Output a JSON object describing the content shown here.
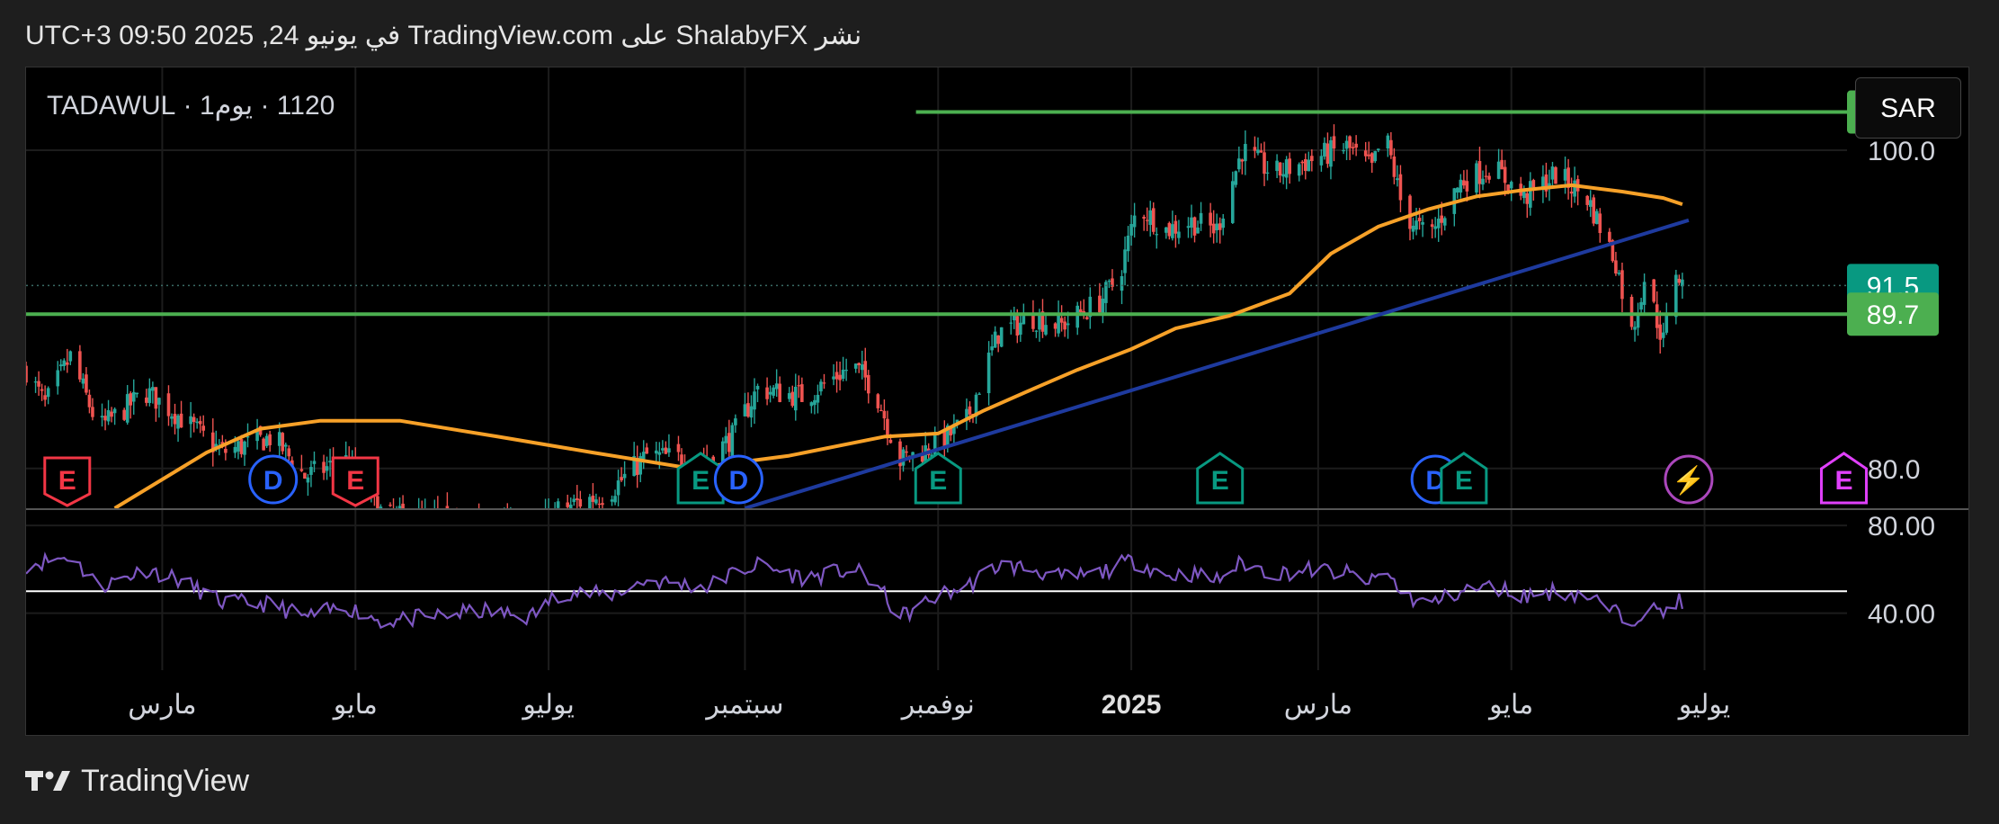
{
  "header": {
    "published": "نشر ShalabyFX على TradingView.com في يونيو 24, 2025 09:50 UTC+3"
  },
  "symbol_line": "1120 · يوم1 · TADAWUL",
  "currency_button": "SAR",
  "footer": {
    "brand": "TradingView",
    "logo_icon": "tradingview-logo-icon"
  },
  "colors": {
    "up": "#26a69a",
    "down": "#ef5350",
    "ema": "#f7a128",
    "trend": "#1e3a9e",
    "hline": "#4caf50",
    "rsi": "#7e57c2",
    "last_price_tag": "#089981",
    "level_tag": "#4caf50"
  },
  "chart_data": [
    {
      "type": "candlestick",
      "x_axis_labels": [
        "مارس",
        "مايو",
        "يوليو",
        "سبتمبر",
        "نوفمبر",
        "2025",
        "مارس",
        "مايو",
        "يوليو"
      ],
      "x_axis_dates": [
        "2024-03-01",
        "2024-05-01",
        "2024-07-01",
        "2024-09-01",
        "2024-11-01",
        "2025-01-01",
        "2025-03-01",
        "2025-05-01",
        "2025-07-01"
      ],
      "x_range": [
        "2024-01-18",
        "2025-08-15"
      ],
      "y_tick_labels": [
        "100.0",
        "80.0"
      ],
      "y_range": [
        77.5,
        105.2
      ],
      "price_keypoints": [
        [
          "2024-01-18",
          86.2
        ],
        [
          "2024-01-24",
          84.0
        ],
        [
          "2024-02-01",
          87.0
        ],
        [
          "2024-02-10",
          82.5
        ],
        [
          "2024-02-25",
          84.8
        ],
        [
          "2024-03-05",
          83.5
        ],
        [
          "2024-03-20",
          81.0
        ],
        [
          "2024-04-05",
          82.0
        ],
        [
          "2024-04-15",
          79.5
        ],
        [
          "2024-04-28",
          80.5
        ],
        [
          "2024-05-10",
          77.0
        ],
        [
          "2024-06-10",
          76.5
        ],
        [
          "2024-06-25",
          76.0
        ],
        [
          "2024-07-05",
          77.5
        ],
        [
          "2024-07-20",
          78.5
        ],
        [
          "2024-08-01",
          80.8
        ],
        [
          "2024-08-20",
          80.5
        ],
        [
          "2024-08-28",
          82.0
        ],
        [
          "2024-09-05",
          85.0
        ],
        [
          "2024-09-20",
          84.5
        ],
        [
          "2024-10-05",
          86.5
        ],
        [
          "2024-10-12",
          85.0
        ],
        [
          "2024-10-20",
          80.5
        ],
        [
          "2024-11-01",
          81.5
        ],
        [
          "2024-11-10",
          83.0
        ],
        [
          "2024-11-20",
          88.5
        ],
        [
          "2024-12-01",
          89.5
        ],
        [
          "2024-12-10",
          89.0
        ],
        [
          "2024-12-22",
          90.5
        ],
        [
          "2024-12-28",
          92.0
        ],
        [
          "2025-01-03",
          96.5
        ],
        [
          "2025-01-12",
          95.0
        ],
        [
          "2025-01-20",
          95.5
        ],
        [
          "2025-01-28",
          95.0
        ],
        [
          "2025-02-05",
          100.0
        ],
        [
          "2025-02-15",
          98.5
        ],
        [
          "2025-02-28",
          99.5
        ],
        [
          "2025-03-10",
          100.2
        ],
        [
          "2025-03-18",
          98.8
        ],
        [
          "2025-03-22",
          101.2
        ],
        [
          "2025-03-28",
          96.0
        ],
        [
          "2025-04-05",
          94.5
        ],
        [
          "2025-04-15",
          98.0
        ],
        [
          "2025-04-25",
          99.0
        ],
        [
          "2025-05-05",
          97.0
        ],
        [
          "2025-05-15",
          98.5
        ],
        [
          "2025-05-25",
          97.0
        ],
        [
          "2025-06-03",
          93.0
        ],
        [
          "2025-06-08",
          88.5
        ],
        [
          "2025-06-12",
          92.0
        ],
        [
          "2025-06-18",
          88.0
        ],
        [
          "2025-06-22",
          92.5
        ],
        [
          "2025-06-24",
          91.5
        ]
      ],
      "ema_keypoints": [
        [
          "2024-02-15",
          77.5
        ],
        [
          "2024-03-15",
          81.0
        ],
        [
          "2024-04-01",
          82.5
        ],
        [
          "2024-04-20",
          83.0
        ],
        [
          "2024-05-15",
          83.0
        ],
        [
          "2024-06-15",
          82.0
        ],
        [
          "2024-07-15",
          81.0
        ],
        [
          "2024-08-15",
          80.0
        ],
        [
          "2024-09-15",
          80.8
        ],
        [
          "2024-10-15",
          82.0
        ],
        [
          "2024-11-01",
          82.2
        ],
        [
          "2024-11-15",
          83.6
        ],
        [
          "2024-12-01",
          85.0
        ],
        [
          "2024-12-15",
          86.2
        ],
        [
          "2025-01-01",
          87.5
        ],
        [
          "2025-01-15",
          88.8
        ],
        [
          "2025-02-01",
          89.6
        ],
        [
          "2025-02-20",
          91.0
        ],
        [
          "2025-03-05",
          93.5
        ],
        [
          "2025-03-20",
          95.2
        ],
        [
          "2025-04-05",
          96.3
        ],
        [
          "2025-04-20",
          97.1
        ],
        [
          "2025-05-05",
          97.5
        ],
        [
          "2025-05-20",
          97.8
        ],
        [
          "2025-06-05",
          97.4
        ],
        [
          "2025-06-18",
          97.0
        ],
        [
          "2025-06-24",
          96.6
        ]
      ],
      "trendline": {
        "from": [
          "2024-09-01",
          77.5
        ],
        "to": [
          "2025-06-26",
          95.6
        ]
      },
      "horizontal_levels": [
        {
          "value": 102.4,
          "from": "2024-10-25",
          "label": "102.4"
        },
        {
          "value": 89.7,
          "from": "2024-01-18",
          "label": "89.7"
        }
      ],
      "last_price": {
        "value": 91.5,
        "label": "91.5"
      },
      "events": [
        {
          "date": "2024-01-31",
          "kind": "E",
          "color": "#f23645",
          "icon": "earnings-icon"
        },
        {
          "date": "2024-04-05",
          "kind": "D",
          "color": "#2962ff",
          "icon": "dividend-icon"
        },
        {
          "date": "2024-05-01",
          "kind": "E",
          "color": "#f23645",
          "icon": "earnings-icon"
        },
        {
          "date": "2024-08-18",
          "kind": "E",
          "color": "#089981",
          "icon": "earnings-icon"
        },
        {
          "date": "2024-08-30",
          "kind": "D",
          "color": "#2962ff",
          "icon": "dividend-icon"
        },
        {
          "date": "2024-11-01",
          "kind": "E",
          "color": "#089981",
          "icon": "earnings-icon"
        },
        {
          "date": "2025-01-29",
          "kind": "E",
          "color": "#089981",
          "icon": "earnings-icon"
        },
        {
          "date": "2025-04-07",
          "kind": "D",
          "color": "#2962ff",
          "icon": "dividend-icon"
        },
        {
          "date": "2025-04-16",
          "kind": "E",
          "color": "#089981",
          "icon": "earnings-icon"
        },
        {
          "date": "2025-06-26",
          "kind": "⚡",
          "color": "#ab47bc",
          "icon": "lightning-icon"
        },
        {
          "date": "2025-08-14",
          "kind": "E",
          "color": "#e040fb",
          "icon": "earnings-icon"
        }
      ]
    },
    {
      "type": "line",
      "name": "",
      "y_tick_labels": [
        "80.00",
        "40.00"
      ],
      "y_range": [
        14,
        87
      ],
      "reference_line": 50,
      "rsi_keypoints": [
        [
          "2024-01-18",
          62
        ],
        [
          "2024-02-01",
          66
        ],
        [
          "2024-02-10",
          52
        ],
        [
          "2024-02-25",
          60
        ],
        [
          "2024-03-05",
          56
        ],
        [
          "2024-03-20",
          45
        ],
        [
          "2024-04-05",
          44
        ],
        [
          "2024-04-15",
          38
        ],
        [
          "2024-04-28",
          43
        ],
        [
          "2024-05-10",
          36
        ],
        [
          "2024-06-10",
          41
        ],
        [
          "2024-06-25",
          38
        ],
        [
          "2024-07-05",
          50
        ],
        [
          "2024-07-20",
          48
        ],
        [
          "2024-08-01",
          55
        ],
        [
          "2024-08-20",
          52
        ],
        [
          "2024-08-28",
          58
        ],
        [
          "2024-09-05",
          62
        ],
        [
          "2024-09-20",
          56
        ],
        [
          "2024-10-05",
          60
        ],
        [
          "2024-10-12",
          54
        ],
        [
          "2024-10-20",
          38
        ],
        [
          "2024-11-01",
          48
        ],
        [
          "2024-11-10",
          52
        ],
        [
          "2024-11-20",
          62
        ],
        [
          "2024-12-01",
          60
        ],
        [
          "2024-12-10",
          56
        ],
        [
          "2024-12-22",
          58
        ],
        [
          "2024-12-28",
          62
        ],
        [
          "2025-01-03",
          64
        ],
        [
          "2025-01-12",
          57
        ],
        [
          "2025-01-20",
          58
        ],
        [
          "2025-01-28",
          55
        ],
        [
          "2025-02-05",
          63
        ],
        [
          "2025-02-15",
          58
        ],
        [
          "2025-02-28",
          60
        ],
        [
          "2025-03-10",
          58
        ],
        [
          "2025-03-18",
          54
        ],
        [
          "2025-03-22",
          60
        ],
        [
          "2025-03-28",
          48
        ],
        [
          "2025-04-05",
          44
        ],
        [
          "2025-04-15",
          50
        ],
        [
          "2025-04-25",
          52
        ],
        [
          "2025-05-05",
          48
        ],
        [
          "2025-05-15",
          50
        ],
        [
          "2025-05-25",
          48
        ],
        [
          "2025-06-03",
          40
        ],
        [
          "2025-06-08",
          37
        ],
        [
          "2025-06-12",
          42
        ],
        [
          "2025-06-18",
          40
        ],
        [
          "2025-06-22",
          46
        ],
        [
          "2025-06-24",
          44
        ]
      ]
    }
  ]
}
